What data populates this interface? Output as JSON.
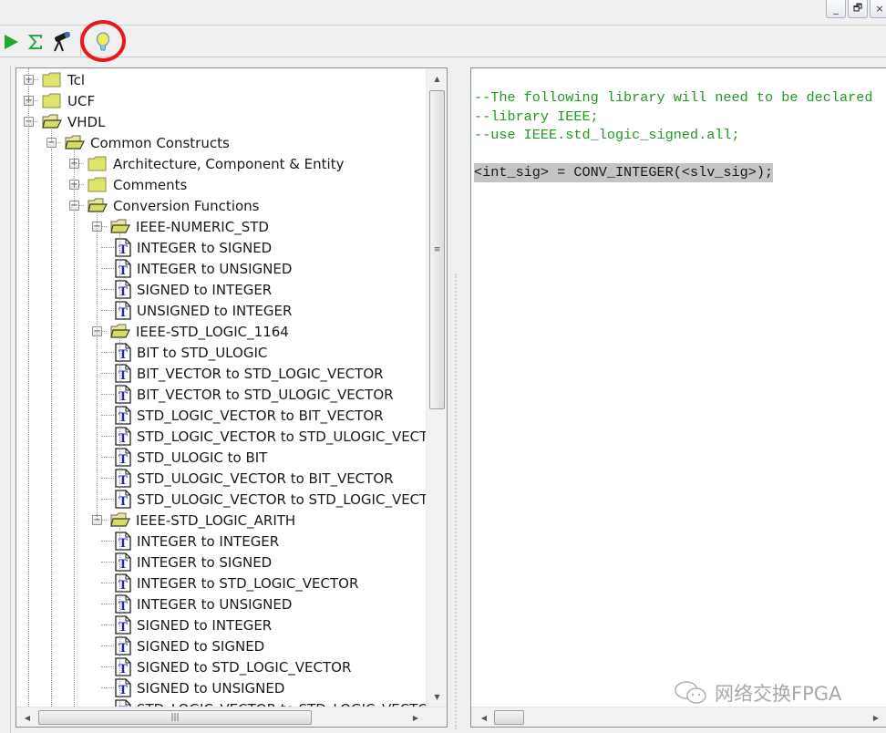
{
  "window": {
    "controls": {
      "minimize": "_",
      "restore": "🗗",
      "close": "×"
    }
  },
  "toolbar": {
    "buttons": [
      {
        "name": "run",
        "icon": "play-icon",
        "color": "#22a832"
      },
      {
        "name": "sum",
        "icon": "sigma-icon",
        "color": "#2aa84a"
      },
      {
        "name": "find",
        "icon": "telescope-icon",
        "color": "#222222"
      },
      {
        "name": "tip",
        "icon": "lightbulb-icon",
        "color": "#f4e040",
        "highlighted": true
      }
    ],
    "highlight_color": "#e8181d"
  },
  "tree": {
    "nodes": [
      {
        "label": "Tcl",
        "type": "folder",
        "level": 0,
        "expanded": false,
        "has_children": true
      },
      {
        "label": "UCF",
        "type": "folder",
        "level": 0,
        "expanded": false,
        "has_children": true
      },
      {
        "label": "VHDL",
        "type": "folder",
        "level": 0,
        "expanded": true,
        "has_children": true
      },
      {
        "label": "Common Constructs",
        "type": "folder",
        "level": 1,
        "expanded": true,
        "has_children": true
      },
      {
        "label": "Architecture, Component & Entity",
        "type": "folder",
        "level": 2,
        "expanded": false,
        "has_children": true
      },
      {
        "label": "Comments",
        "type": "folder",
        "level": 2,
        "expanded": false,
        "has_children": true
      },
      {
        "label": "Conversion Functions",
        "type": "folder",
        "level": 2,
        "expanded": true,
        "has_children": true
      },
      {
        "label": "IEEE-NUMERIC_STD",
        "type": "folder",
        "level": 3,
        "expanded": true,
        "has_children": true
      },
      {
        "label": "INTEGER to SIGNED",
        "type": "template",
        "level": 4
      },
      {
        "label": "INTEGER to UNSIGNED",
        "type": "template",
        "level": 4
      },
      {
        "label": "SIGNED to INTEGER",
        "type": "template",
        "level": 4
      },
      {
        "label": "UNSIGNED to INTEGER",
        "type": "template",
        "level": 4
      },
      {
        "label": "IEEE-STD_LOGIC_1164",
        "type": "folder",
        "level": 3,
        "expanded": true,
        "has_children": true
      },
      {
        "label": "BIT to STD_ULOGIC",
        "type": "template",
        "level": 4
      },
      {
        "label": "BIT_VECTOR to STD_LOGIC_VECTOR",
        "type": "template",
        "level": 4
      },
      {
        "label": "BIT_VECTOR to STD_ULOGIC_VECTOR",
        "type": "template",
        "level": 4
      },
      {
        "label": "STD_LOGIC_VECTOR to BIT_VECTOR",
        "type": "template",
        "level": 4
      },
      {
        "label": "STD_LOGIC_VECTOR to STD_ULOGIC_VECTOR",
        "type": "template",
        "level": 4
      },
      {
        "label": "STD_ULOGIC to BIT",
        "type": "template",
        "level": 4
      },
      {
        "label": "STD_ULOGIC_VECTOR to BIT_VECTOR",
        "type": "template",
        "level": 4
      },
      {
        "label": "STD_ULOGIC_VECTOR to STD_LOGIC_VECTOR",
        "type": "template",
        "level": 4
      },
      {
        "label": "IEEE-STD_LOGIC_ARITH",
        "type": "folder",
        "level": 3,
        "expanded": true,
        "has_children": true
      },
      {
        "label": "INTEGER to INTEGER",
        "type": "template",
        "level": 4
      },
      {
        "label": "INTEGER to SIGNED",
        "type": "template",
        "level": 4
      },
      {
        "label": "INTEGER to STD_LOGIC_VECTOR",
        "type": "template",
        "level": 4
      },
      {
        "label": "INTEGER to UNSIGNED",
        "type": "template",
        "level": 4
      },
      {
        "label": "SIGNED to INTEGER",
        "type": "template",
        "level": 4
      },
      {
        "label": "SIGNED to SIGNED",
        "type": "template",
        "level": 4
      },
      {
        "label": "SIGNED to STD_LOGIC_VECTOR",
        "type": "template",
        "level": 4
      },
      {
        "label": "SIGNED to UNSIGNED",
        "type": "template",
        "level": 4
      },
      {
        "label": "STD_LOGIC_VECTOR to STD_LOGIC_VECTOR",
        "type": "template",
        "level": 4
      }
    ],
    "scrollbar": {
      "up": "▲",
      "down": "▼",
      "left": "◀",
      "right": "▶",
      "grip": "≡"
    }
  },
  "code": {
    "lines": [
      {
        "text": "--The following library will need to be declared",
        "kind": "comment"
      },
      {
        "text": "--library IEEE;",
        "kind": "comment"
      },
      {
        "text": "--use IEEE.std_logic_signed.all;",
        "kind": "comment"
      },
      {
        "text": "",
        "kind": "blank"
      },
      {
        "text": "<int_sig> = CONV_INTEGER(<slv_sig>);",
        "kind": "selected"
      }
    ],
    "colors": {
      "comment": "#1e9a1e",
      "selection": "#c4c4c4"
    }
  },
  "watermark": {
    "text": "网络交换FPGA",
    "icon": "wechat-icon"
  }
}
